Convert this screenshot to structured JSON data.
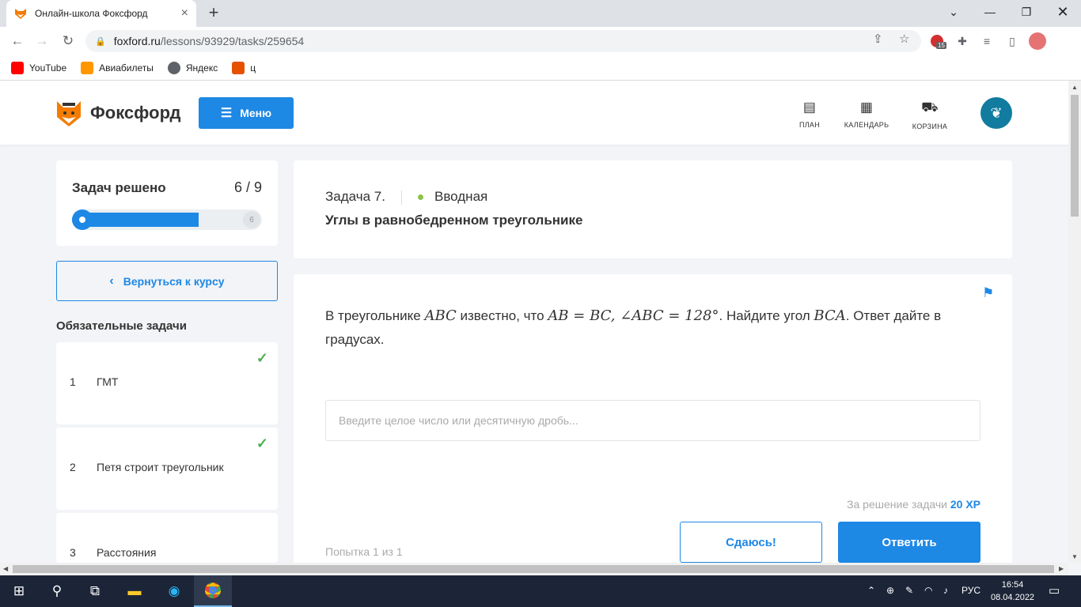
{
  "browser": {
    "tab_title": "Онлайн-школа Фоксфорд",
    "url_host": "foxford.ru",
    "url_path": "/lessons/93929/tasks/259654",
    "ext_badge": "15",
    "bookmarks": [
      {
        "label": "YouTube",
        "color": "#ff0000"
      },
      {
        "label": "Авиабилеты",
        "color": "#ff9800"
      },
      {
        "label": "Яндекс",
        "color": "#5f6368"
      },
      {
        "label": "ц",
        "color": "#e65100"
      }
    ]
  },
  "header": {
    "logo_text": "Фоксфорд",
    "menu_label": "Меню",
    "nav": [
      {
        "label": "ПЛАН",
        "icon": "document-icon"
      },
      {
        "label": "КАЛЕНДАРЬ",
        "icon": "calendar-icon"
      },
      {
        "label": "КОРЗИНА",
        "icon": "cart-icon"
      }
    ]
  },
  "sidebar": {
    "progress_label": "Задач решено",
    "progress_count": "6 / 9",
    "progress_solved": 6,
    "progress_total": 9,
    "progress_end_label": "6",
    "back_label": "Вернуться к курсу",
    "section_title": "Обязательные задачи",
    "tasks": [
      {
        "num": "1",
        "title": "ГМТ",
        "done": true
      },
      {
        "num": "2",
        "title": "Петя строит треугольник",
        "done": true
      },
      {
        "num": "3",
        "title": "Расстояния",
        "done": false
      }
    ]
  },
  "task": {
    "number": "Задача 7.",
    "level": "Вводная",
    "title": "Углы в равнобедренном треугольнике",
    "problem_a": "В треугольнике ",
    "m1": "ABC",
    "problem_b": " известно, что ",
    "m2": "AB = BC, ∠ABC = 128°",
    "problem_c": ". Найдите угол ",
    "m3": "BCA",
    "problem_d": ". Ответ дайте в градусах.",
    "answer_placeholder": "Введите целое число или десятичную дробь...",
    "reward_text": "За решение задачи",
    "reward_xp": "20 XP",
    "attempt": "Попытка 1 из 1",
    "giveup_label": "Сдаюсь!",
    "submit_label": "Ответить"
  },
  "taskbar": {
    "lang": "РУС",
    "time": "16:54",
    "date": "08.04.2022"
  }
}
